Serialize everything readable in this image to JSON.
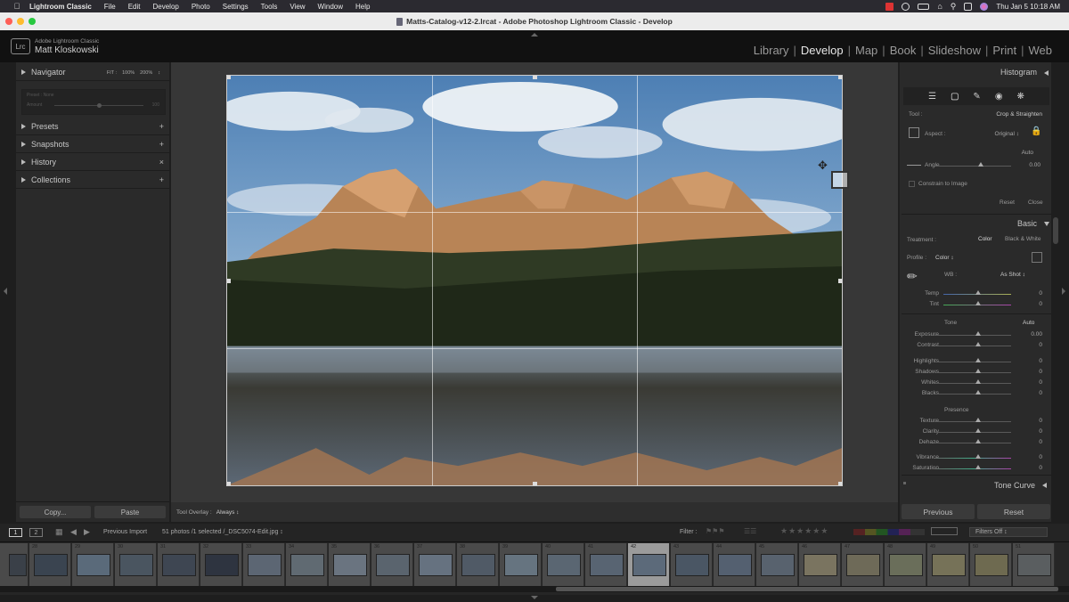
{
  "menubar": {
    "app_name": "Lightroom Classic",
    "items": [
      "File",
      "Edit",
      "Develop",
      "Photo",
      "Settings",
      "Tools",
      "View",
      "Window",
      "Help"
    ],
    "clock": "Thu Jan 5  10:18 AM"
  },
  "window": {
    "title": "Matts-Catalog-v12-2.lrcat - Adobe Photoshop Lightroom Classic - Develop"
  },
  "identity": {
    "logo": "Lrc",
    "product": "Adobe Lightroom Classic",
    "user": "Matt Kloskowski"
  },
  "modules": {
    "library": "Library",
    "develop": "Develop",
    "map": "Map",
    "book": "Book",
    "slideshow": "Slideshow",
    "print": "Print",
    "web": "Web",
    "active": "Develop"
  },
  "left_panel": {
    "navigator": {
      "label": "Navigator",
      "opt_fit": "FIT :",
      "opt_100": "100%",
      "opt_200": "200%",
      "opt_more": "↕"
    },
    "preview": {
      "title": "Preset : None",
      "left": "Amount",
      "right": "100"
    },
    "sections": [
      {
        "label": "Presets",
        "action": "+"
      },
      {
        "label": "Snapshots",
        "action": "+"
      },
      {
        "label": "History",
        "action": "×"
      },
      {
        "label": "Collections",
        "action": "+"
      }
    ],
    "copy_button": "Copy...",
    "paste_button": "Paste"
  },
  "toolbar": {
    "label": "Tool Overlay :",
    "value": "Always ↕"
  },
  "right_panel": {
    "histogram_label": "Histogram",
    "crop": {
      "tool_label": "Tool :",
      "tool_value": "Crop & Straighten",
      "aspect_label": "Aspect :",
      "aspect_value": "Original ↕",
      "auto": "Auto",
      "angle_label": "Angle",
      "angle_value": "0.00",
      "constrain": "Constrain to Image",
      "reset": "Reset",
      "close": "Close"
    },
    "basic": {
      "header": "Basic",
      "treatment_label": "Treatment :",
      "color": "Color",
      "bw": "Black & White",
      "profile_label": "Profile :",
      "profile_value": "Color ↕",
      "wb_label": "WB :",
      "wb_value": "As Shot ↕",
      "temp_label": "Temp",
      "temp_value": "0",
      "tint_label": "Tint",
      "tint_value": "0",
      "tone_label": "Tone",
      "tone_auto": "Auto",
      "sliders": [
        {
          "label": "Exposure",
          "value": "0.00"
        },
        {
          "label": "Contrast",
          "value": "0"
        },
        {
          "label": "Highlights",
          "value": "0"
        },
        {
          "label": "Shadows",
          "value": "0"
        },
        {
          "label": "Whites",
          "value": "0"
        },
        {
          "label": "Blacks",
          "value": "0"
        }
      ],
      "presence_label": "Presence",
      "presence": [
        {
          "label": "Texture",
          "value": "0"
        },
        {
          "label": "Clarity",
          "value": "0"
        },
        {
          "label": "Dehaze",
          "value": "0"
        },
        {
          "label": "Vibrance",
          "value": "0"
        },
        {
          "label": "Saturation",
          "value": "0"
        }
      ]
    },
    "tone_curve_label": "Tone Curve",
    "previous_button": "Previous",
    "reset_button": "Reset"
  },
  "filmstrip": {
    "page1": "1",
    "page2": "2",
    "source": "Previous Import",
    "count": "51 photos /1 selected /_DSC5074-Edit.jpg ↕",
    "filter_label": "Filter :",
    "filters_off": "Filters Off ↕",
    "numbers": [
      "28",
      "29",
      "30",
      "31",
      "32",
      "33",
      "34",
      "35",
      "36",
      "37",
      "38",
      "39",
      "40",
      "41",
      "42",
      "43",
      "44",
      "45",
      "46",
      "47",
      "48",
      "49",
      "50",
      "51"
    ],
    "selected": "42"
  },
  "colors": {
    "accent": "#e6e6e6",
    "panel": "#2a2a2a",
    "background": "#373737"
  }
}
